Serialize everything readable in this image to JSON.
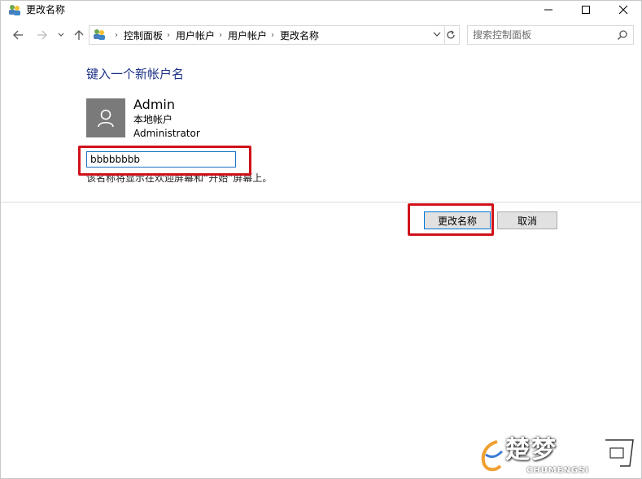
{
  "window": {
    "title": "更改名称",
    "controls": {
      "minimize": "—",
      "maximize": "☐",
      "close": "✕"
    }
  },
  "navigation": {
    "back_icon": "arrow-left-icon",
    "forward_icon": "arrow-right-icon",
    "recent_icon": "chevron-down-icon",
    "up_icon": "arrow-up-icon",
    "breadcrumbs": [
      "控制面板",
      "用户帐户",
      "用户帐户",
      "更改名称"
    ],
    "search_placeholder": "搜索控制面板"
  },
  "content": {
    "heading": "键入一个新帐户名",
    "account": {
      "name": "Admin",
      "type": "本地帐户",
      "role": "Administrator"
    },
    "new_name_value": "bbbbbbbb",
    "hint": "该名称将显示在欢迎屏幕和“开始”屏幕上。"
  },
  "buttons": {
    "rename": "更改名称",
    "cancel": "取消"
  },
  "highlight_color": "#d0121b",
  "accent_color": "#1e3287",
  "watermark": {
    "main": "楚梦",
    "sub": "CHUMENGSI"
  }
}
